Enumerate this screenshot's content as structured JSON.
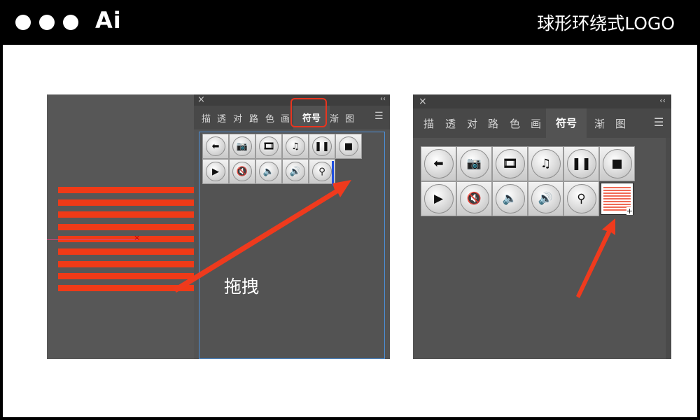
{
  "header": {
    "brand": "Ai",
    "slide_title": "球形环绕式LOGO"
  },
  "left_screenshot": {
    "stripe_color": "#f03a17",
    "stripe_count": 9,
    "panel": {
      "close": "×",
      "collapse": "‹‹",
      "tabs": [
        "描",
        "透",
        "对",
        "路",
        "色",
        "画",
        "符号",
        "渐",
        "图"
      ],
      "active_tab": "符号",
      "menu": "☰"
    },
    "annotation": "拖拽"
  },
  "right_screenshot": {
    "panel": {
      "close": "×",
      "collapse": "‹‹",
      "tabs": [
        "描",
        "透",
        "对",
        "路",
        "色",
        "画",
        "符号",
        "渐",
        "图"
      ],
      "active_tab": "符号",
      "menu": "☰"
    },
    "new_symbol_badge": "+"
  },
  "symbols": [
    {
      "name": "arrow-left-icon",
      "glyph": "⬅"
    },
    {
      "name": "camera-icon",
      "glyph": "📷"
    },
    {
      "name": "film-icon",
      "glyph": "🎞"
    },
    {
      "name": "music-note-icon",
      "glyph": "♫"
    },
    {
      "name": "pause-icon",
      "glyph": "❚❚"
    },
    {
      "name": "stop-icon",
      "glyph": "■"
    },
    {
      "name": "play-icon",
      "glyph": "▶"
    },
    {
      "name": "mute-icon",
      "glyph": "🔇"
    },
    {
      "name": "volume-low-icon",
      "glyph": "🔈"
    },
    {
      "name": "volume-high-icon",
      "glyph": "🔊"
    },
    {
      "name": "search-icon",
      "glyph": "⚲"
    }
  ],
  "accent_color": "#e8351f"
}
